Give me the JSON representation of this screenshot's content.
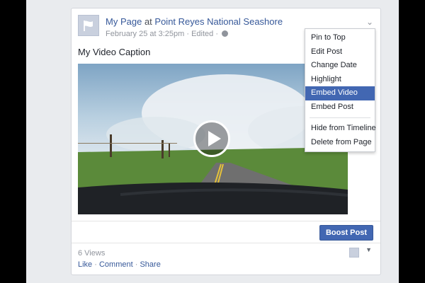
{
  "post": {
    "page_name": "My Page",
    "at_word": "at",
    "location": "Point Reyes National Seashore",
    "date": "February 25 at 3:25pm",
    "meta_sep": "·",
    "edited": "Edited",
    "caption": "My Video Caption",
    "boost_label": "Boost Post",
    "views": "6 Views",
    "actions": {
      "like": "Like",
      "comment": "Comment",
      "share": "Share",
      "sep": "·"
    }
  },
  "menu": {
    "items": [
      "Pin to Top",
      "Edit Post",
      "Change Date",
      "Highlight",
      "Embed Video",
      "Embed Post"
    ],
    "items2": [
      "Hide from Timeline",
      "Delete from Page"
    ],
    "active": "Embed Video"
  },
  "colors": {
    "accent": "#4267b2",
    "link": "#365899"
  },
  "icons": [
    "flag-icon",
    "chevron-down-icon",
    "globe-icon",
    "play-icon"
  ]
}
